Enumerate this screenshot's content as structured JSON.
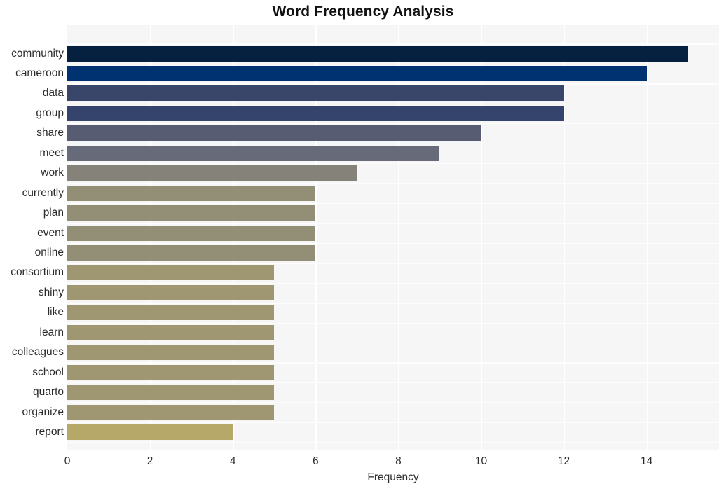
{
  "chart_data": {
    "type": "bar",
    "orientation": "horizontal",
    "title": "Word Frequency Analysis",
    "xlabel": "Frequency",
    "ylabel": "",
    "categories": [
      "community",
      "cameroon",
      "data",
      "group",
      "share",
      "meet",
      "work",
      "currently",
      "plan",
      "event",
      "online",
      "consortium",
      "shiny",
      "like",
      "learn",
      "colleagues",
      "school",
      "quarto",
      "organize",
      "report"
    ],
    "values": [
      15,
      14,
      12,
      12,
      10,
      9,
      7,
      6,
      6,
      6,
      6,
      5,
      5,
      5,
      5,
      5,
      5,
      5,
      5,
      4
    ],
    "bar_colors": [
      "#06203f",
      "#003271",
      "#394669",
      "#35446d",
      "#585c73",
      "#666a79",
      "#848279",
      "#938f77",
      "#938f77",
      "#938f77",
      "#938f77",
      "#9e9771",
      "#9e9771",
      "#9e9771",
      "#9e9771",
      "#9e9771",
      "#9e9771",
      "#9e9771",
      "#9e9771",
      "#b5a868"
    ],
    "xticks": [
      0,
      2,
      4,
      6,
      8,
      10,
      12,
      14
    ],
    "xtick_labels": [
      "0",
      "2",
      "4",
      "6",
      "8",
      "10",
      "12",
      "14"
    ],
    "xlim": [
      0,
      15.75
    ],
    "grid": "white gridlines on light gray panel",
    "legend": "none",
    "plot_bgcolor": "#f6f6f7",
    "figure_bgcolor": "#ffffff",
    "gridline_color": "#ffffff",
    "text_color": "#2b2b2b"
  }
}
